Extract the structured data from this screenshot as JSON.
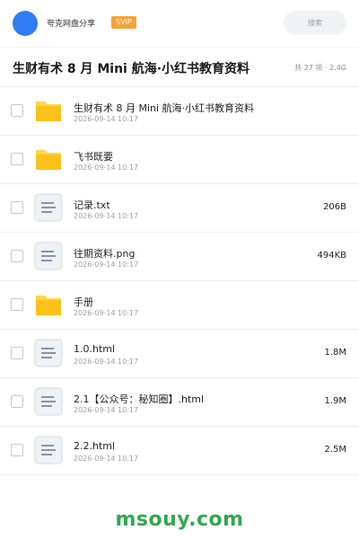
{
  "header": {
    "username": "夸克网盘分享",
    "badge": "SVIP",
    "search_placeholder": "搜索"
  },
  "folder": {
    "title": "生财有术 8 月 Mini 航海·小红书教育资料",
    "summary": "共 27 项 · 2.4G"
  },
  "files": [
    {
      "name": "生财有术 8 月 Mini 航海·小红书教育资料",
      "date": "2026-09-14 10:17",
      "size": "",
      "type": "folder"
    },
    {
      "name": "飞书既要",
      "date": "2026-09-14 10:17",
      "size": "",
      "type": "folder"
    },
    {
      "name": "记录.txt",
      "date": "2026-09-14 10:17",
      "size": "206B",
      "type": "file"
    },
    {
      "name": "往期资料.png",
      "date": "2026-09-14 10:17",
      "size": "494KB",
      "type": "file"
    },
    {
      "name": "手册",
      "date": "2026-09-14 10:17",
      "size": "",
      "type": "folder"
    },
    {
      "name": "1.0.html",
      "date": "2026-09-14 10:17",
      "size": "1.8M",
      "type": "file"
    },
    {
      "name": "2.1【公众号：秘知圈】.html",
      "date": "2026-09-14 10:17",
      "size": "1.9M",
      "type": "file"
    },
    {
      "name": "2.2.html",
      "date": "2026-09-14 10:17",
      "size": "2.5M",
      "type": "file"
    }
  ],
  "watermark": "msouy.com",
  "colors": {
    "accent": "#2f7cf6",
    "svip": "#f6a23a",
    "folder": "#fcc21b",
    "watermark": "#2fa84f"
  }
}
